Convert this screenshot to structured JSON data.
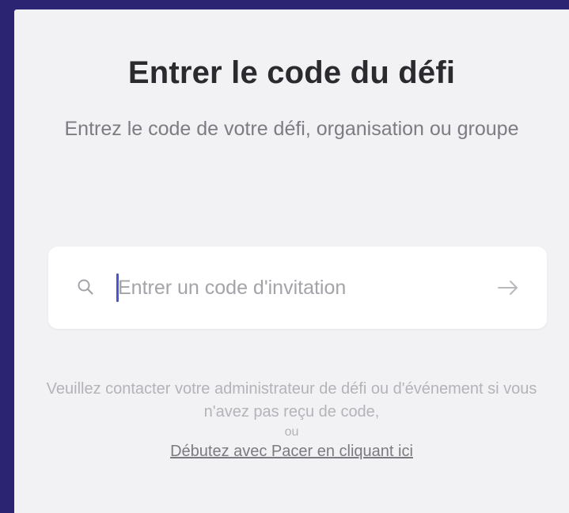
{
  "header": {
    "title": "Entrer le code du défi",
    "subtitle": "Entrez le code de votre défi, organisation ou groupe"
  },
  "search": {
    "placeholder": "Entrer un code d'invitation",
    "value": "",
    "icon": "search-icon",
    "submit_icon": "arrow-right-icon"
  },
  "footer": {
    "help_text": "Veuillez contacter votre administrateur de défi ou d'événement si vous n'avez pas reçu de code,",
    "or_text": "ou",
    "link_text": "Débutez avec Pacer en cliquant ici"
  },
  "colors": {
    "background": "#2b2473",
    "panel": "#f2f2f4",
    "caret": "#4a52d8"
  }
}
